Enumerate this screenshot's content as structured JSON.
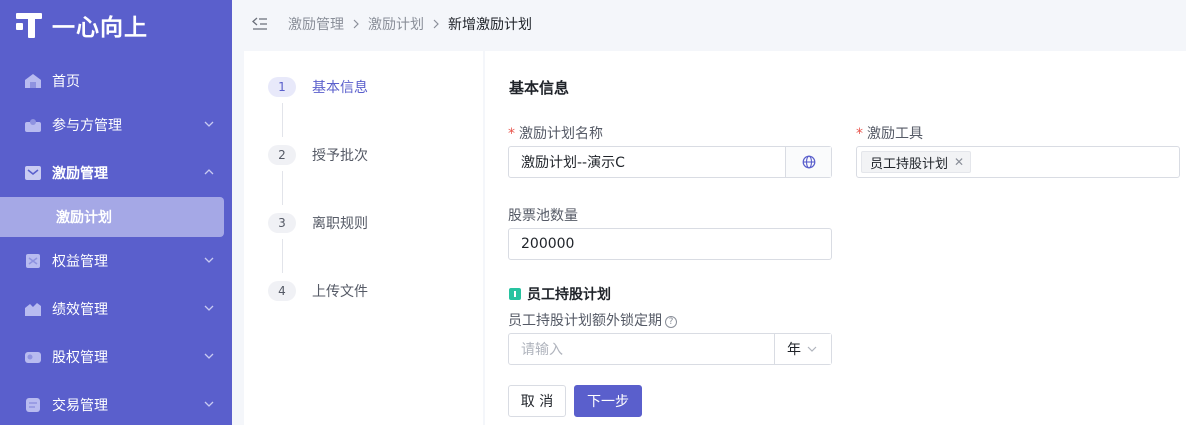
{
  "brand": {
    "logo_text": "一心向上"
  },
  "sidebar": {
    "items": [
      {
        "label": "首页",
        "icon": "home-icon"
      },
      {
        "label": "参与方管理",
        "icon": "participants-icon"
      },
      {
        "label": "激励管理",
        "icon": "incentive-icon",
        "expanded": true
      },
      {
        "label": "权益管理",
        "icon": "equity-rights-icon"
      },
      {
        "label": "绩效管理",
        "icon": "performance-icon"
      },
      {
        "label": "股权管理",
        "icon": "shares-icon"
      },
      {
        "label": "交易管理",
        "icon": "trade-icon"
      }
    ],
    "active_subitem": "激励计划"
  },
  "breadcrumb": {
    "items": [
      "激励管理",
      "激励计划",
      "新增激励计划"
    ]
  },
  "steps": [
    {
      "num": "1",
      "label": "基本信息",
      "active": true
    },
    {
      "num": "2",
      "label": "授予批次",
      "active": false
    },
    {
      "num": "3",
      "label": "离职规则",
      "active": false
    },
    {
      "num": "4",
      "label": "上传文件",
      "active": false
    }
  ],
  "form": {
    "section_title": "基本信息",
    "plan_name": {
      "label": "激励计划名称",
      "value": "激励计划--演示C",
      "required": true
    },
    "tool": {
      "label": "激励工具",
      "tag": "员工持股计划",
      "required": true
    },
    "pool": {
      "label": "股票池数量",
      "value": "200000"
    },
    "plan_section": "员工持股计划",
    "lock": {
      "label": "员工持股计划额外锁定期",
      "placeholder": "请输入",
      "unit": "年"
    },
    "cancel_label": "取 消",
    "next_label": "下一步"
  },
  "colors": {
    "primary": "#5a5fcc",
    "required": "#e8534b",
    "badge": "#27c3a0"
  }
}
